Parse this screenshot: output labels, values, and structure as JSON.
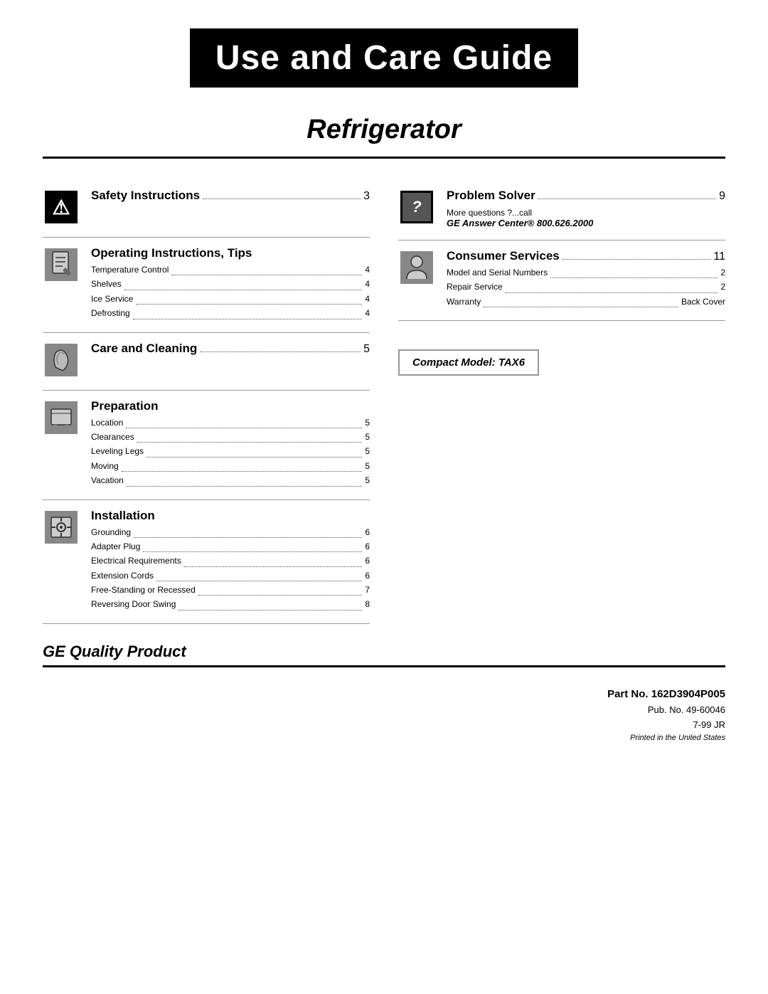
{
  "header": {
    "title": "Use and Care Guide"
  },
  "subtitle": "Refrigerator",
  "left_sections": [
    {
      "id": "safety",
      "title": "Safety Instructions",
      "page": "3",
      "icon_type": "warning",
      "items": []
    },
    {
      "id": "operating",
      "title": "Operating Instructions, Tips",
      "page": "",
      "icon_type": "gray",
      "items": [
        {
          "label": "Temperature Control",
          "page": "4"
        },
        {
          "label": "Shelves",
          "page": "4"
        },
        {
          "label": "Ice Service",
          "page": "4"
        },
        {
          "label": "Defrosting",
          "page": "4"
        }
      ]
    },
    {
      "id": "care",
      "title": "Care and Cleaning",
      "page": "5",
      "icon_type": "gray",
      "items": []
    },
    {
      "id": "preparation",
      "title": "Preparation",
      "page": "",
      "icon_type": "gray",
      "items": [
        {
          "label": "Location",
          "page": "5"
        },
        {
          "label": "Clearances",
          "page": "5"
        },
        {
          "label": "Leveling Legs",
          "page": "5"
        },
        {
          "label": "Moving",
          "page": "5"
        },
        {
          "label": "Vacation",
          "page": "5"
        }
      ]
    },
    {
      "id": "installation",
      "title": "Installation",
      "page": "",
      "icon_type": "gray",
      "items": [
        {
          "label": "Grounding",
          "page": "6"
        },
        {
          "label": "Adapter Plug",
          "page": "6"
        },
        {
          "label": "Electrical Requirements",
          "page": "6"
        },
        {
          "label": "Extension Cords",
          "page": "6"
        },
        {
          "label": "Free-Standing or Recessed",
          "page": "7"
        },
        {
          "label": "Reversing Door Swing",
          "page": "8"
        }
      ]
    }
  ],
  "right_sections": [
    {
      "id": "problem",
      "title": "Problem Solver",
      "page": "9",
      "icon_type": "question",
      "sub_text": "More questions ?...call",
      "ge_answer": "GE Answer Center® 800.626.2000",
      "items": []
    },
    {
      "id": "consumer",
      "title": "Consumer Services",
      "page": "11",
      "icon_type": "gray",
      "items": [
        {
          "label": "Model and Serial Numbers",
          "page": "2"
        },
        {
          "label": "Repair Service",
          "page": "2"
        },
        {
          "label": "Warranty",
          "page": "Back Cover"
        }
      ]
    }
  ],
  "model_box": "Compact Model: TAX6",
  "footer": {
    "quality_label": "GE Quality Product",
    "part_no": "Part No. 162D3904P005",
    "pub_no": "Pub. No. 49-60046",
    "date": "7-99 JR",
    "printed": "Printed in the United States"
  }
}
